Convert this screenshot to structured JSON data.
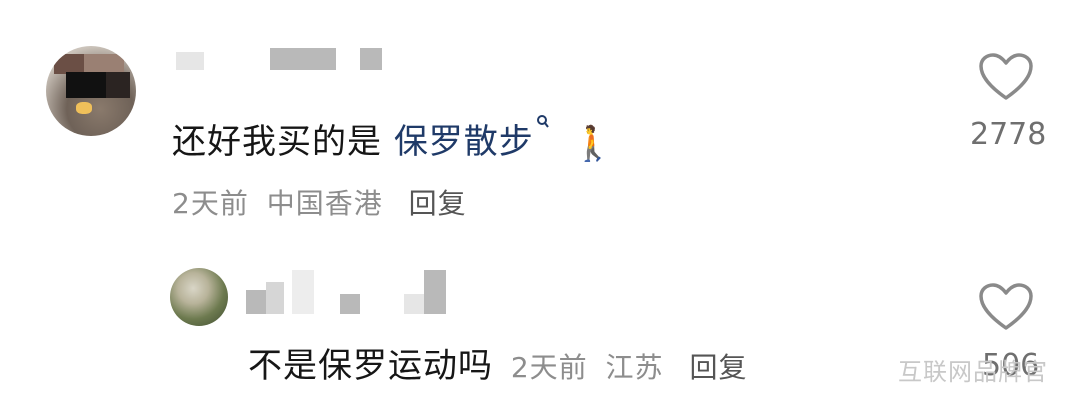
{
  "comments": [
    {
      "text_prefix": "还好我买的是",
      "link": "保罗散步",
      "emoji": "🚶",
      "time": "2天前",
      "location": "中国香港",
      "reply_label": "回复",
      "likes": "2778"
    },
    {
      "text": "不是保罗运动吗",
      "time": "2天前",
      "location": "江苏",
      "reply_label": "回复",
      "likes": "506"
    }
  ],
  "watermark": "互联网品牌官",
  "colors": {
    "text": "#161616",
    "link": "#1f3a68",
    "meta": "#8d8d8d",
    "heart": "#8a8a8a"
  }
}
